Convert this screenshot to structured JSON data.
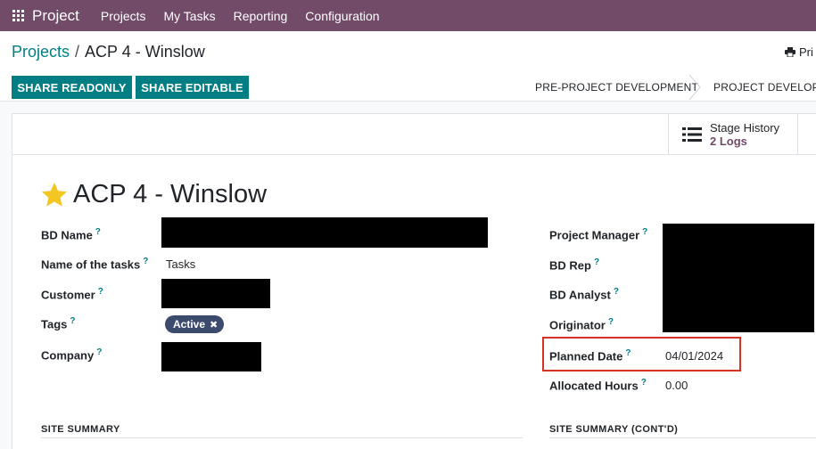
{
  "navbar": {
    "brand": "Project",
    "menu": [
      "Projects",
      "My Tasks",
      "Reporting",
      "Configuration"
    ]
  },
  "breadcrumb": {
    "parent": "Projects",
    "separator": "/",
    "current": "ACP 4 - Winslow"
  },
  "toolbar": {
    "print_label": "Pri"
  },
  "actions": {
    "share_readonly": "SHARE READONLY",
    "share_editable": "SHARE EDITABLE"
  },
  "stages": [
    "PRE-PROJECT DEVELOPMENT",
    "PROJECT DEVELOPM"
  ],
  "stat_button": {
    "label": "Stage History",
    "value": "2 Logs"
  },
  "record": {
    "title": "ACP 4 - Winslow",
    "favorite": true
  },
  "fields_left": {
    "bd_name": "BD Name",
    "task_name_label": "Name of the tasks",
    "task_name_value": "Tasks",
    "customer": "Customer",
    "tags": "Tags",
    "tag_active": "Active",
    "company": "Company"
  },
  "fields_right": {
    "project_manager": "Project Manager",
    "bd_rep": "BD Rep",
    "bd_analyst": "BD Analyst",
    "originator": "Originator",
    "planned_date_label": "Planned Date",
    "planned_date_value": "04/01/2024",
    "allocated_hours_label": "Allocated Hours",
    "allocated_hours_value": "0.00"
  },
  "help_mark": "?",
  "sections": {
    "left": "SITE SUMMARY",
    "right": "SITE SUMMARY (CONT'D)"
  },
  "colors": {
    "navbar": "#714b67",
    "primary": "#017e84",
    "tag": "#3c4a6e",
    "highlight": "#d93025",
    "star": "#f3c623"
  }
}
